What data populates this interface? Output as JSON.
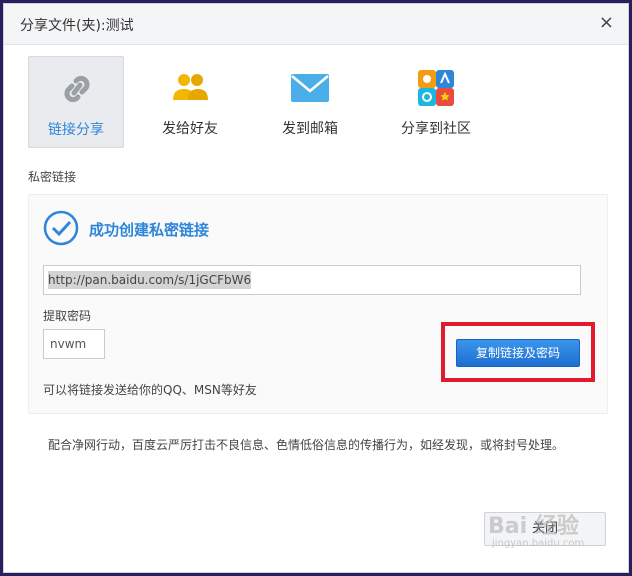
{
  "dialog": {
    "title": "分享文件(夹):测试",
    "close_glyph": "×"
  },
  "tabs": [
    {
      "label": "链接分享",
      "icon": "link-icon",
      "active": true
    },
    {
      "label": "发给好友",
      "icon": "friends-icon",
      "active": false
    },
    {
      "label": "发到邮箱",
      "icon": "mail-icon",
      "active": false
    },
    {
      "label": "分享到社区",
      "icon": "community-icon",
      "active": false
    }
  ],
  "private_link": {
    "section_label": "私密链接",
    "success_text": "成功创建私密链接",
    "link_value": "http://pan.baidu.com/s/1jGCFbW6",
    "password_label": "提取密码",
    "password_value": "nvwm",
    "copy_button_label": "复制链接及密码",
    "hint": "可以将链接发送给你的QQ、MSN等好友"
  },
  "notice": "配合净网行动，百度云严厉打击不良信息、色情低俗信息的传播行为，如经发现，或将封号处理。",
  "footer": {
    "close_button_label": "关闭"
  },
  "watermark": {
    "text": "Bai 经验",
    "sub": "jingyan.baidu.com"
  },
  "colors": {
    "accent": "#2d86d9",
    "highlight": "#e21a2c",
    "button": "#1e6fd0"
  }
}
